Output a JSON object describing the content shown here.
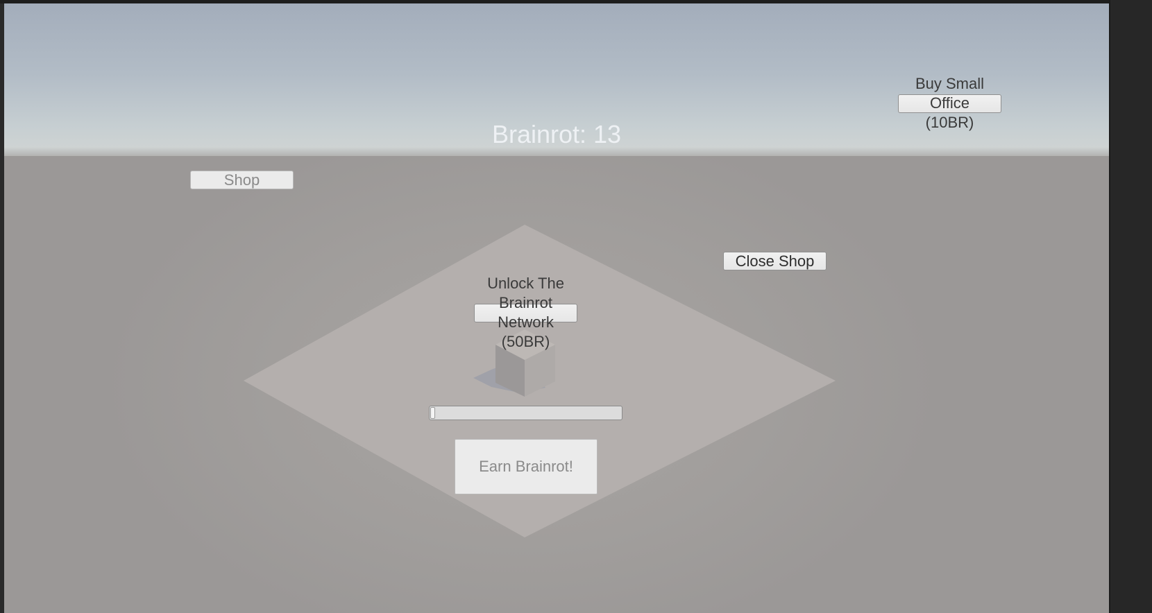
{
  "hud": {
    "counter_text": "Brainrot: 13"
  },
  "buttons": {
    "shop_label": "Shop",
    "close_shop_label": "Close Shop",
    "buy_small_office_line1": "Buy Small",
    "buy_small_office_line2": "Office",
    "buy_small_office_line3": "(10BR)",
    "unlock_network_line1": "Unlock The",
    "unlock_network_line2": "Brainrot",
    "unlock_network_line3": "Network",
    "unlock_network_line4": "(50BR)",
    "earn_label": "Earn Brainrot!"
  },
  "progress": {
    "fraction": 0.02
  },
  "colors": {
    "sky_top": "#a3adbb",
    "horizon": "#ced3d3",
    "ground": "#9c9998",
    "plane": "#b4afad",
    "button_face": "#ececec"
  }
}
